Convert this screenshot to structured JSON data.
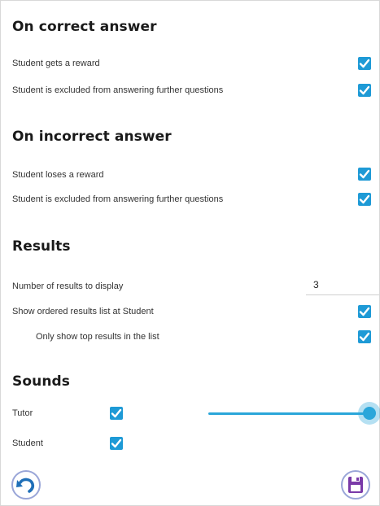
{
  "sections": {
    "correct": {
      "title": "On correct answer",
      "items": [
        {
          "label": "Student gets a reward",
          "checked": true
        },
        {
          "label": "Student is excluded from answering further questions",
          "checked": true
        }
      ]
    },
    "incorrect": {
      "title": "On incorrect answer",
      "items": [
        {
          "label": "Student loses a reward",
          "checked": true
        },
        {
          "label": "Student is excluded from answering further questions",
          "checked": true
        }
      ]
    },
    "results": {
      "title": "Results",
      "number_label": "Number of results to display",
      "number_value": "3",
      "items": [
        {
          "label": "Show ordered results list at Student",
          "checked": true
        },
        {
          "label": "Only show top results in the list",
          "checked": true
        }
      ]
    },
    "sounds": {
      "title": "Sounds",
      "tutor_label": "Tutor",
      "tutor_checked": true,
      "tutor_volume_fraction": 1.0,
      "student_label": "Student",
      "student_checked": true
    }
  },
  "footer": {
    "undo_icon": "undo-icon",
    "save_icon": "floppy-disk-icon"
  },
  "colors": {
    "accent": "#1e9ad6",
    "slider": "#2aa6da",
    "button_ring": "#9aa6d8",
    "undo_arrow": "#1f6fb8",
    "save_icon": "#7a3aa8"
  }
}
